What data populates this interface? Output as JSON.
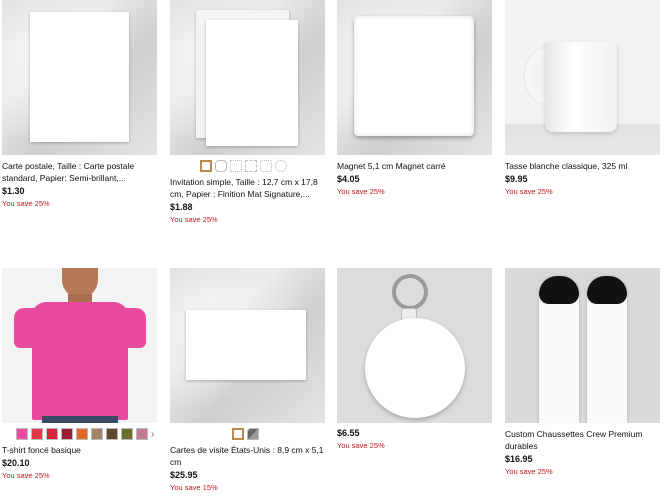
{
  "products": [
    {
      "title": "Carte postale, Taille : Carte postale standard, Papier: Semi-brillant,...",
      "price": "$1.30",
      "save": "You save 25%",
      "image": "blank-postcard"
    },
    {
      "title": "Invitation simple, Taille : 12,7 cm x 17,8 cm, Papier : Finition Mat Signature,...",
      "price": "$1.88",
      "save": "You save 25%",
      "image": "blank-invitation"
    },
    {
      "title": "Magnet 5,1 cm Magnet carré",
      "price": "$4.05",
      "save": "You save 25%",
      "image": "blank-square-magnet"
    },
    {
      "title": "Tasse blanche classique, 325 ml",
      "price": "$9.95",
      "save": "You save 25%",
      "image": "white-mug"
    },
    {
      "title": "T-shirt foncé basique",
      "price": "$20.10",
      "save": "You save 25%",
      "image": "pink-tshirt-model"
    },
    {
      "title": "Cartes de visite États-Unis : 8,9 cm x 5,1 cm",
      "price": "$25.95",
      "save": "You save 15%",
      "image": "blank-business-card"
    },
    {
      "title": "",
      "price": "$6.55",
      "save": "You save 25%",
      "image": "round-keychain"
    },
    {
      "title": "Custom Chaussettes Crew Premium durables",
      "price": "$16.95",
      "save": "You save 25%",
      "image": "white-crew-socks"
    }
  ],
  "tshirt_colors": [
    "#ec4aa2",
    "#e23a4a",
    "#d4253a",
    "#9c1e34",
    "#e06a25",
    "#a08466",
    "#5d4a2e",
    "#6b6e2c",
    "#c27a8f"
  ],
  "invitation_shapes": [
    "rectangle",
    "rounded",
    "scalloped",
    "ticket",
    "notched",
    "circle"
  ],
  "card_colors": [
    "#b07a4a",
    "#666666"
  ]
}
